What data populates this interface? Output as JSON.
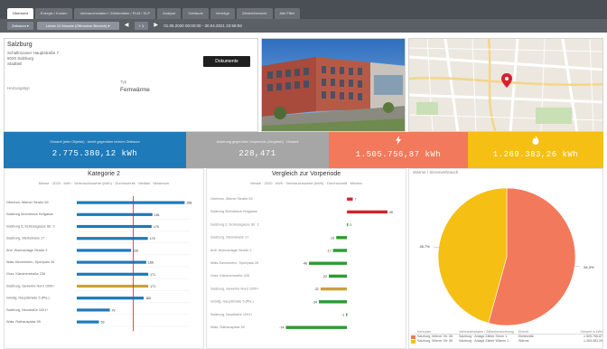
{
  "tabs": [
    {
      "label": "Übersicht",
      "active": true
    },
    {
      "label": "Energie / Kosten",
      "active": false
    },
    {
      "label": "Verbrauchsdaten / Zählerdaten / RLM / SLP",
      "active": false
    },
    {
      "label": "Analyse",
      "active": false
    },
    {
      "label": "Gebäude",
      "active": false
    },
    {
      "label": "Verträge",
      "active": false
    },
    {
      "label": "Zählerübersicht",
      "active": false
    },
    {
      "label": "Alle Filter",
      "active": false
    }
  ],
  "filterbar": {
    "zeitraum_label": "Zeitraum ▾",
    "period_select": "Letzte 12 Monate (Offensiver Bereich) ▾",
    "prev": "◀",
    "step": "+ 1",
    "next": "▶",
    "daterange": "01.05.2020 00:00:00 - 30.04.2021 23:59:59"
  },
  "info": {
    "title": "Salzburg",
    "address_line1": "Schallmooser Hauptstraße 7",
    "address_line2": "5020 Salzburg",
    "address_line3": "Stadtteil",
    "left_label": "Heizungstyp",
    "type_label": "Typ",
    "type_value": "Fernwärme",
    "doc_button": "Dokumente"
  },
  "kpis": [
    {
      "label": "Gesamt (aller Objekte) · Anteil gegenüber letztem Zeitraum",
      "value": "2.775.380,12 kWh",
      "icon": ""
    },
    {
      "label": "Änderung gegenüber Vorperiode (Vergleich) · Gesamt",
      "value": "228,471",
      "icon": ""
    },
    {
      "label": "",
      "value": "1.505.756,87 kWh",
      "icon": "lightning-icon"
    },
    {
      "label": "",
      "value": "1.269.383,26 kWh",
      "icon": "flame-icon"
    }
  ],
  "colors": {
    "blue": "#1e7ab8",
    "grey": "#a6a6a6",
    "coral": "#f2795b",
    "yellow": "#f5bf13",
    "bar_gold": "#c9a23a",
    "red_line": "#d9202e",
    "neg_green": "#2f9a32",
    "pos_red": "#d9202e"
  },
  "panel_left": {
    "title": "Kategorie 2",
    "subtitle": "Messe · 2020 · kWh · Verbrauchswerte (kWh) · Durchschnitt · Median · Maximum",
    "chart_data": {
      "type": "bar",
      "orientation": "horizontal",
      "categories": [
        "Obertum, Wiener Straße 55",
        "Salzburg Wohnblock Hofgasse",
        "Salzburg 2, Schlossgasse Str. 2",
        "Salzburg, Sternstraße 17",
        "Anif, Wohnanlage Straße 2",
        "Wals-Siezenheim, Sportpark 26",
        "Graz, Kärntnerstraße 226",
        "Salzburg, Gewerbe Nord 1000+",
        "Grödig, Hauptstraße 5 (Pla.)",
        "Salzburg, Neustraße 1001+",
        "Wals, Rathausplatz 59"
      ],
      "values": [
        258,
        181,
        179,
        170,
        130,
        166,
        171,
        171,
        160,
        79,
        53
      ],
      "data_labels": [
        "258",
        "181",
        "179",
        "170",
        "130",
        "166",
        "171",
        "171",
        "160",
        "79",
        "53"
      ],
      "highlight_index": 7,
      "reference_line": 135,
      "xlim": [
        0,
        270
      ]
    }
  },
  "panel_mid": {
    "title": "Vergleich zur Vorperiode",
    "subtitle": "Messe · 2020 · kWh · Verbrauchswerte (kWh) · Durchschnitt · Median",
    "chart_data": {
      "type": "bar",
      "orientation": "horizontal",
      "categories": [
        "Obertum, Wiener Straße 55",
        "Salzburg Wohnblock Hofgasse",
        "Salzburg 2, Schlossgasse Str. 2",
        "Salzburg, Sternstraße 17",
        "Anif, Wohnanlage Straße 2",
        "Wals-Siezenheim, Sportpark 26",
        "Graz, Kärntnerstraße 226",
        "Salzburg, Gewerbe Nord 1000+",
        "Grödig, Hauptstraße 5 (Pla.)",
        "Salzburg, Neustraße 1001+",
        "Wals, Rathausplatz 59"
      ],
      "values": [
        7,
        49,
        0,
        -13,
        -17,
        -46,
        -22,
        -32,
        -34,
        -1,
        -74
      ],
      "data_labels": [
        "7",
        "49",
        "0",
        "-13",
        "-17",
        "-46",
        "-22",
        "-32",
        "-34",
        "-1",
        "-74"
      ],
      "highlight_index": 7,
      "xlim": [
        -80,
        60
      ]
    }
  },
  "panel_right": {
    "title": "Wärme / Stromverbrauch",
    "chart_data": {
      "type": "pie",
      "slices": [
        {
          "name": "Strom",
          "value": 54.3,
          "label": "54,3%",
          "color": "#f2795b"
        },
        {
          "name": "Wärme",
          "value": 45.7,
          "label": "45,7%",
          "color": "#f5bf13"
        }
      ]
    },
    "legend_header": [
      "Kennzahl",
      "Verbrauchsdaten / Zählerbezeichnung",
      "Einheit",
      "Gesamt in kWh"
    ],
    "legend_rows": [
      {
        "c1": "Salzburg, Wiener Str. 55",
        "c2": "Salzburg · Anlage Zähler Strom 1",
        "c3": "Elektrizität",
        "c4": "1.505.756,87",
        "color": "#f2795b"
      },
      {
        "c1": "Salzburg, Wiener Str. 55",
        "c2": "Salzburg · Anlage Zähler Wärme 1",
        "c3": "Wärme",
        "c4": "1.269.383,26",
        "color": "#f5bf13"
      }
    ]
  }
}
